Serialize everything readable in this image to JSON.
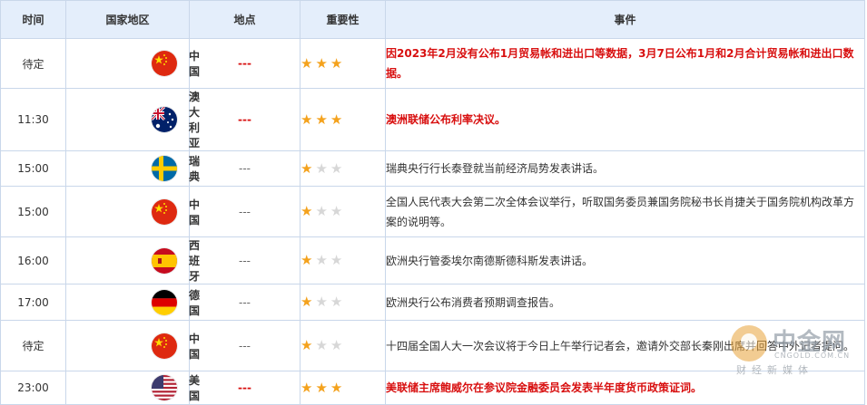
{
  "header": {
    "time": "时间",
    "country": "国家地区",
    "location": "地点",
    "importance": "重要性",
    "event": "事件"
  },
  "colors": {
    "header_bg": "#e4eefb",
    "border": "#c9d7ea",
    "highlight_red": "#d80f0f",
    "star_on": "#f4a21d",
    "star_off": "#d7d7d7"
  },
  "rows": [
    {
      "time": "待定",
      "country": "中国",
      "flag": "china-flag-icon",
      "location": "---",
      "stars": 3,
      "highlight": true,
      "event": "因2023年2月没有公布1月贸易帐和进出口等数据，3月7日公布1月和2月合计贸易帐和进出口数据。"
    },
    {
      "time": "11:30",
      "country": "澳大利亚",
      "flag": "australia-flag-icon",
      "location": "---",
      "stars": 3,
      "highlight": true,
      "event": "澳洲联储公布利率决议。"
    },
    {
      "time": "15:00",
      "country": "瑞典",
      "flag": "sweden-flag-icon",
      "location": "---",
      "stars": 1,
      "highlight": false,
      "event": "瑞典央行行长泰登就当前经济局势发表讲话。"
    },
    {
      "time": "15:00",
      "country": "中国",
      "flag": "china-flag-icon",
      "location": "---",
      "stars": 1,
      "highlight": false,
      "event": "全国人民代表大会第二次全体会议举行，听取国务委员兼国务院秘书长肖捷关于国务院机构改革方案的说明等。"
    },
    {
      "time": "16:00",
      "country": "西班牙",
      "flag": "spain-flag-icon",
      "location": "---",
      "stars": 1,
      "highlight": false,
      "event": "欧洲央行管委埃尔南德斯德科斯发表讲话。"
    },
    {
      "time": "17:00",
      "country": "德国",
      "flag": "germany-flag-icon",
      "location": "---",
      "stars": 1,
      "highlight": false,
      "event": "欧洲央行公布消费者预期调查报告。"
    },
    {
      "time": "待定",
      "country": "中国",
      "flag": "china-flag-icon",
      "location": "---",
      "stars": 1,
      "highlight": false,
      "event": "十四届全国人大一次会议将于今日上午举行记者会，邀请外交部长秦刚出席并回答中外记者提问。"
    },
    {
      "time": "23:00",
      "country": "美国",
      "flag": "usa-flag-icon",
      "location": "---",
      "stars": 3,
      "highlight": true,
      "event": "美联储主席鲍威尔在参议院金融委员会发表半年度货币政策证词。"
    }
  ],
  "watermark": {
    "name": "中金网",
    "url": "CNGOLD.COM.CN",
    "slogan": "财经新媒体"
  }
}
